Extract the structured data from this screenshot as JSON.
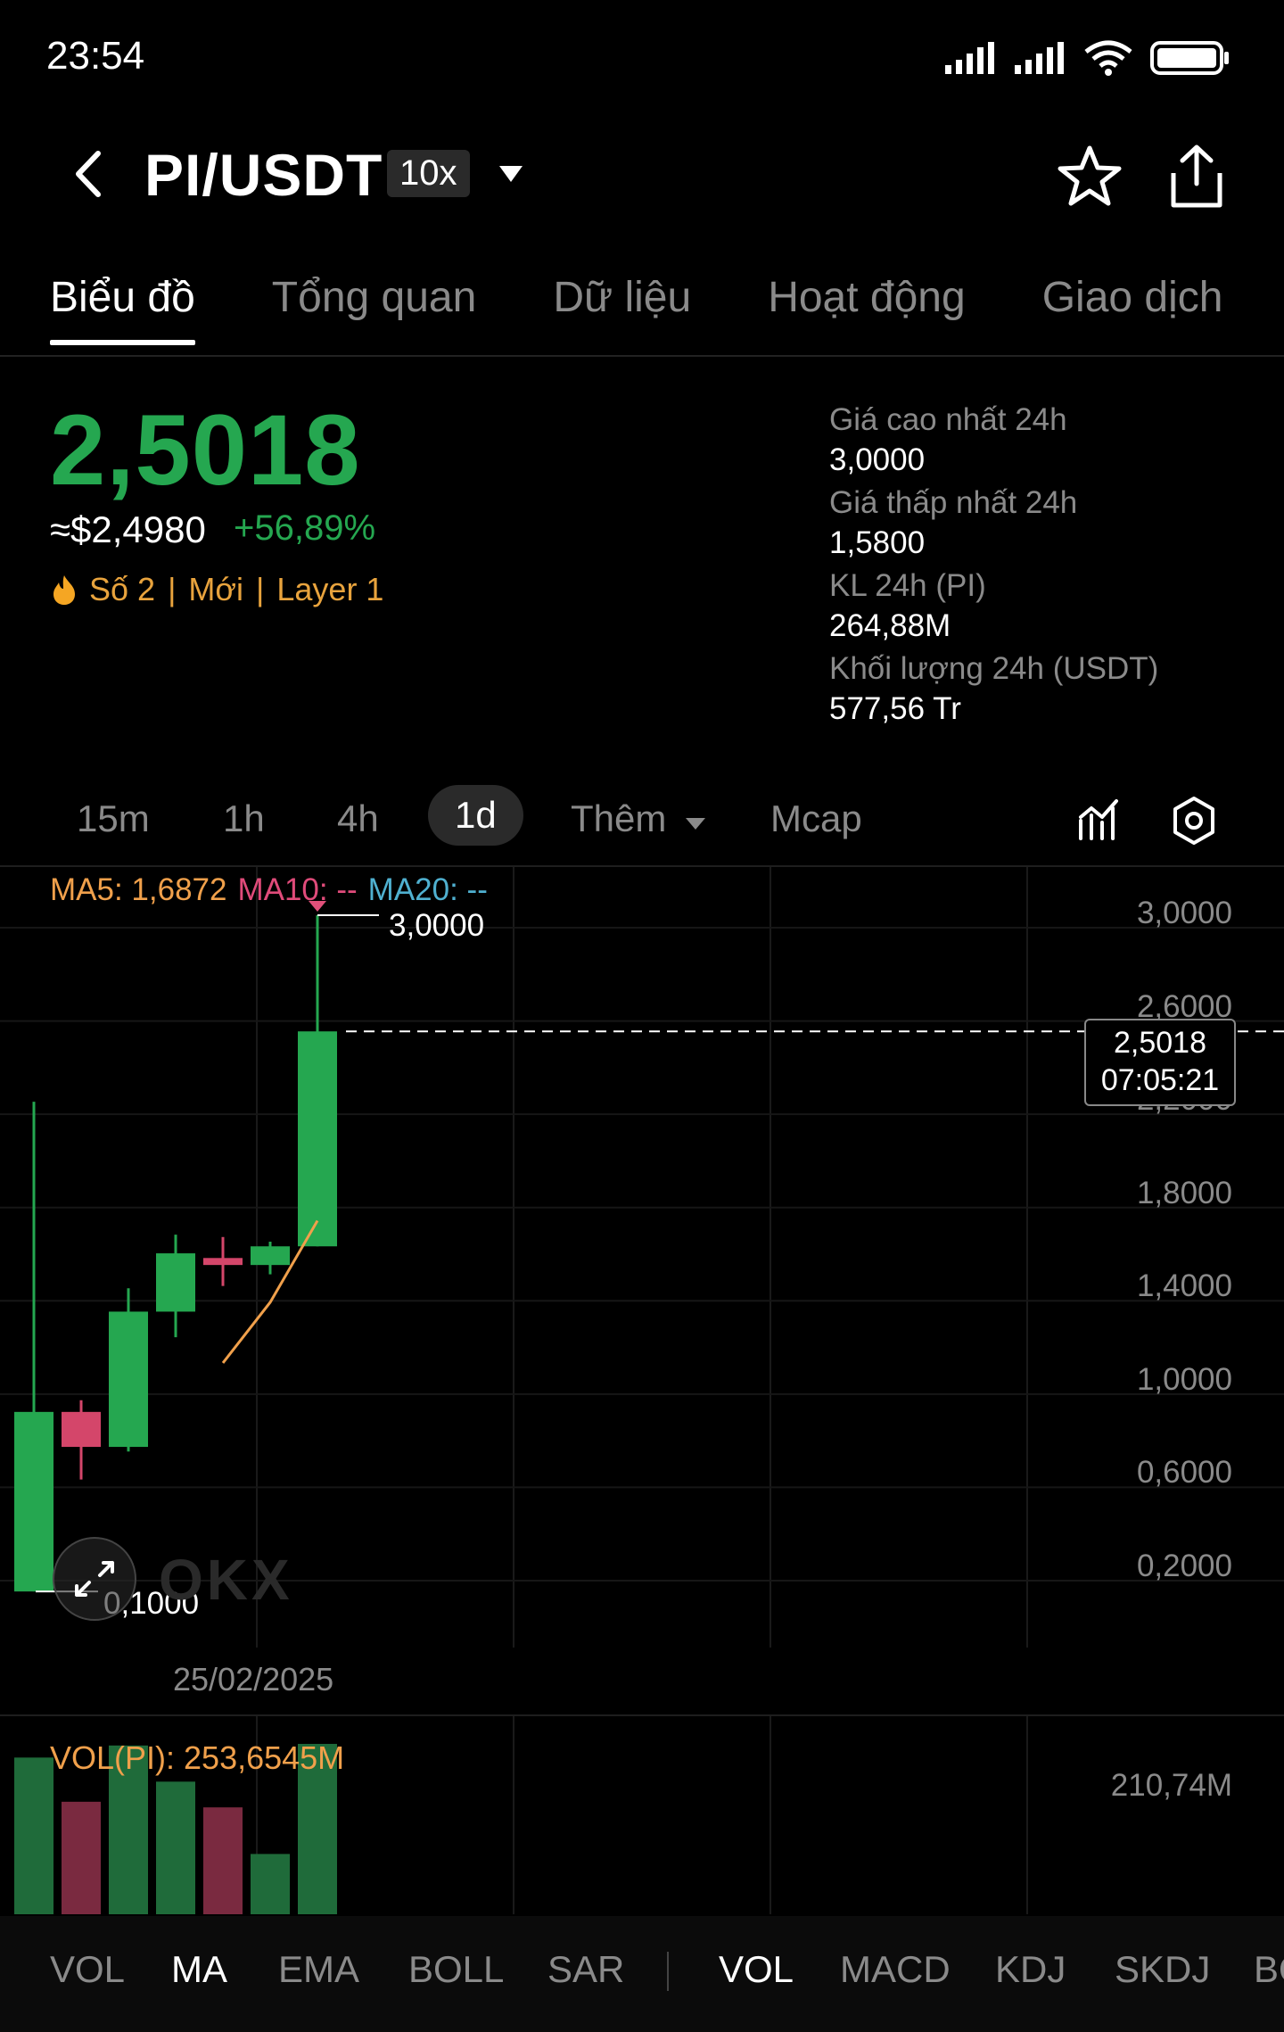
{
  "status": {
    "time": "23:54"
  },
  "header": {
    "pair": "PI/USDT",
    "leverage": "10x"
  },
  "tabs": [
    {
      "label": "Biểu đồ",
      "active": true
    },
    {
      "label": "Tổng quan",
      "active": false
    },
    {
      "label": "Dữ liệu",
      "active": false
    },
    {
      "label": "Hoạt động",
      "active": false
    },
    {
      "label": "Giao dịch",
      "active": false
    }
  ],
  "price": {
    "last": "2,5018",
    "usd": "≈$2,4980",
    "change": "+56,89%",
    "tags": [
      "Số 2",
      "Mới",
      "Layer 1"
    ],
    "up_color": "#25a750",
    "down_color": "#d4466a"
  },
  "stats": [
    {
      "label": "Giá cao nhất 24h",
      "value": "3,0000"
    },
    {
      "label": "Giá thấp nhất 24h",
      "value": "1,5800"
    },
    {
      "label": "KL 24h (PI)",
      "value": "264,88M"
    },
    {
      "label": "Khối lượng 24h (USDT)",
      "value": "577,56 Tr"
    }
  ],
  "intervals": [
    {
      "label": "15m",
      "active": false
    },
    {
      "label": "1h",
      "active": false
    },
    {
      "label": "4h",
      "active": false
    },
    {
      "label": "1d",
      "active": true
    },
    {
      "label": "Thêm",
      "active": false
    },
    {
      "label": "Mcap",
      "active": false
    }
  ],
  "ma_legend": {
    "ma5": "MA5: 1,6872",
    "ma10": "MA10: --",
    "ma20": "MA20: --"
  },
  "chart_data": {
    "type": "candlestick",
    "y_axis_labels": [
      "3,0000",
      "2,6000",
      "2,2000",
      "1,8000",
      "1,4000",
      "1,0000",
      "0,6000",
      "0,2000"
    ],
    "ylim": [
      0.05,
      3.05
    ],
    "x_label": "25/02/2025",
    "high_marker": "3,0000",
    "low_marker": "0,1000",
    "current_price": "2,5018",
    "countdown": "07:05:21",
    "candles": [
      {
        "open": 0.1,
        "high": 2.2,
        "low": 0.1,
        "close": 0.87
      },
      {
        "open": 0.87,
        "high": 0.92,
        "low": 0.58,
        "close": 0.72
      },
      {
        "open": 0.72,
        "high": 1.4,
        "low": 0.7,
        "close": 1.3
      },
      {
        "open": 1.3,
        "high": 1.63,
        "low": 1.19,
        "close": 1.55
      },
      {
        "open": 1.53,
        "high": 1.62,
        "low": 1.41,
        "close": 1.5
      },
      {
        "open": 1.5,
        "high": 1.6,
        "low": 1.46,
        "close": 1.58
      },
      {
        "open": 1.58,
        "high": 3.0,
        "low": 1.58,
        "close": 2.5018
      }
    ],
    "ma5": [
      null,
      null,
      null,
      null,
      1.08,
      1.34,
      1.69
    ],
    "volume": {
      "legend": "VOL(PI): 253,6545M",
      "axis_label": "210,74M",
      "max": 222,
      "values": [
        195,
        140,
        210,
        165,
        133,
        75,
        212
      ]
    }
  },
  "bottom_indicators": [
    {
      "label": "VOL",
      "active": false
    },
    {
      "label": "MA",
      "active": true
    },
    {
      "label": "EMA",
      "active": false
    },
    {
      "label": "BOLL",
      "active": false
    },
    {
      "label": "SAR",
      "active": false
    },
    {
      "label": "VOL",
      "active": true
    },
    {
      "label": "MACD",
      "active": false
    },
    {
      "label": "KDJ",
      "active": false
    },
    {
      "label": "SKDJ",
      "active": false
    },
    {
      "label": "BO",
      "active": false
    }
  ],
  "watermark": "OKX"
}
